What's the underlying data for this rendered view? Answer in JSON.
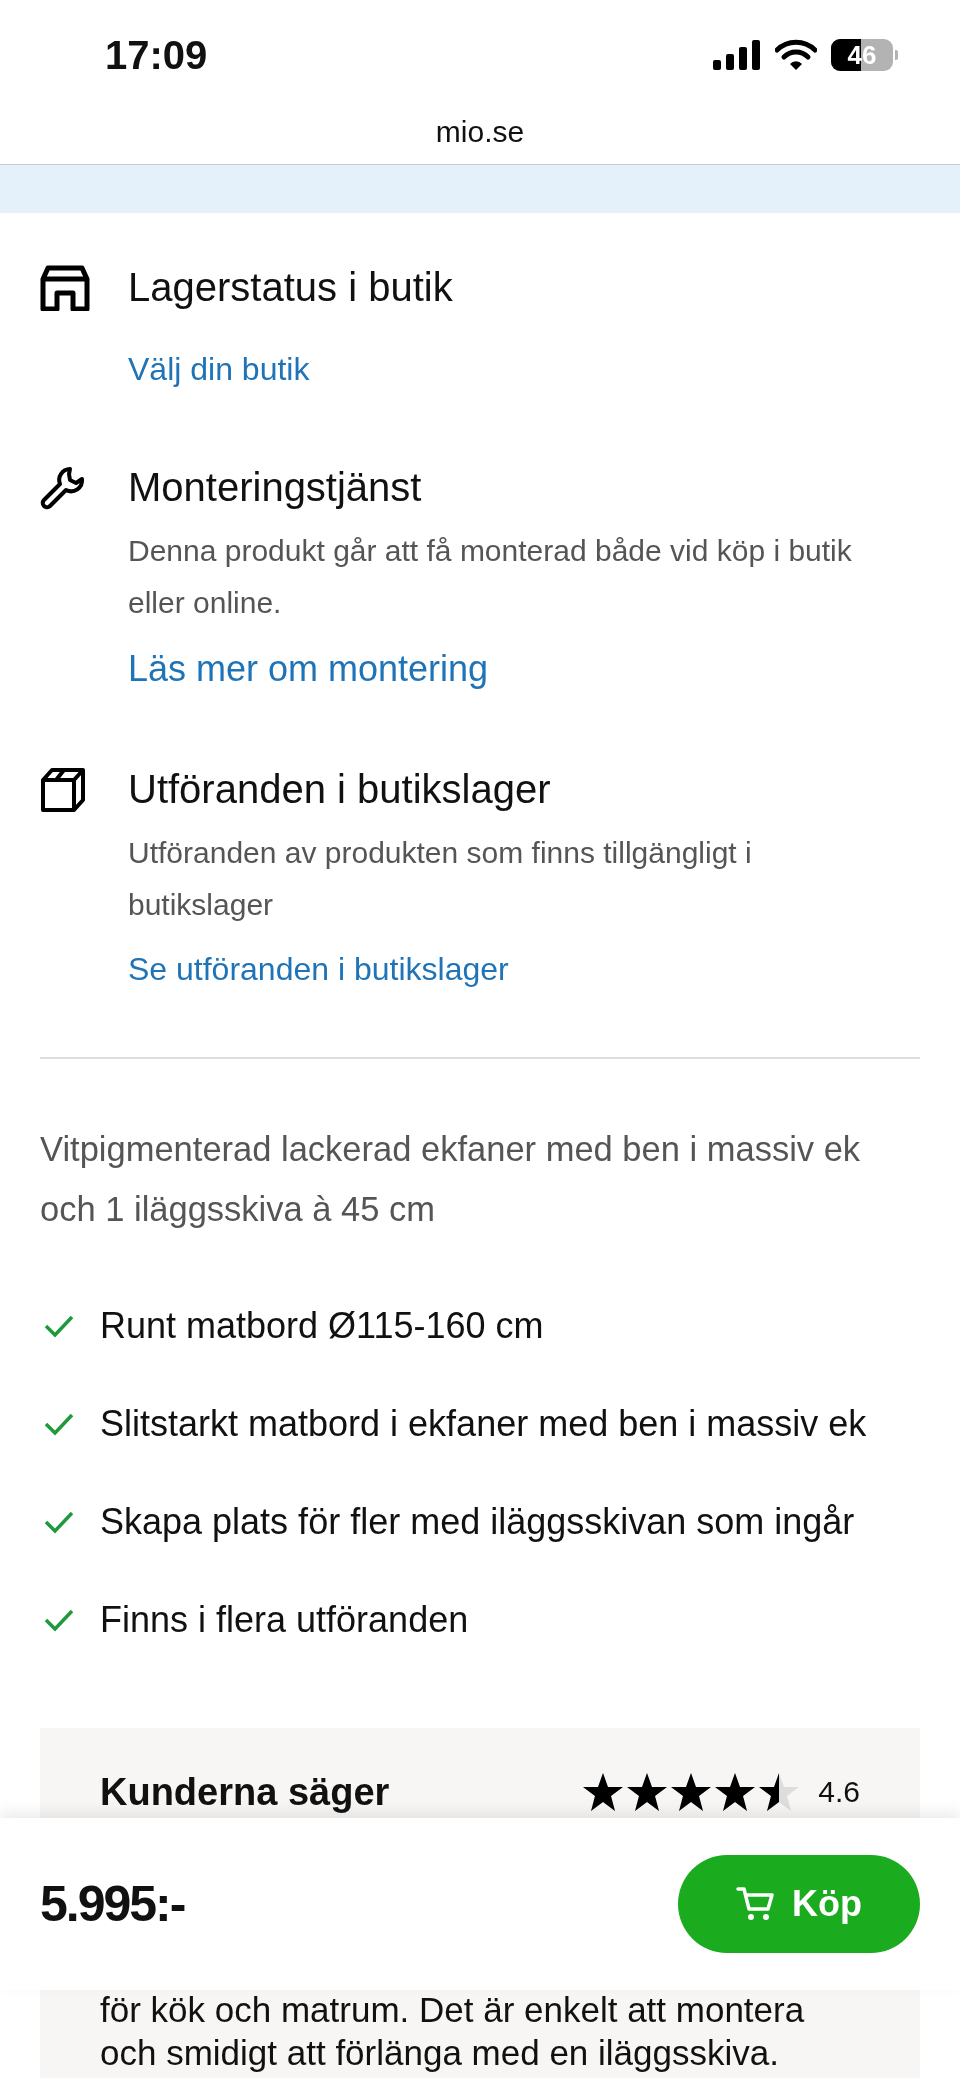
{
  "status_bar": {
    "time": "17:09",
    "battery": "46"
  },
  "address_bar": {
    "url": "mio.se"
  },
  "services": [
    {
      "kind": "store",
      "title": "Lagerstatus i butik",
      "link": "Välj din butik"
    },
    {
      "kind": "wrench",
      "title": "Monteringstjänst",
      "description": "Denna produkt går att få monterad både vid köp i butik eller online.",
      "link": "Läs mer om montering"
    },
    {
      "kind": "box",
      "title": "Utföranden i butikslager",
      "description": "Utföranden av produkten som finns tillgängligt i butikslager",
      "link": "Se utföranden i butikslager"
    }
  ],
  "summary": "Vitpigmenterad lackerad ekfaner med ben i massiv ek och 1 iläggsskiva à 45 cm",
  "features": [
    "Runt matbord Ø115-160 cm",
    "Slitstarkt matbord i ekfaner med ben i massiv ek",
    "Skapa plats för fler med iläggsskivan som ingår",
    "Finns i flera utföranden"
  ],
  "reviews": {
    "title": "Kunderna säger",
    "stars": 4.5,
    "rating": "4.6",
    "text": "för kök och matrum. Det är enkelt att montera och smidigt att förlänga med en iläggsskiva."
  },
  "buy_bar": {
    "price": "5.995:-",
    "button": "Köp"
  }
}
